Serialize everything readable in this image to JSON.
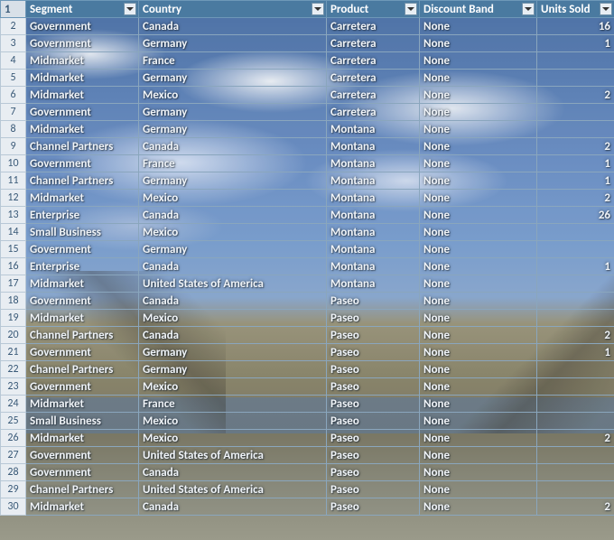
{
  "header": {
    "row_number": "1",
    "columns": [
      "Segment",
      "Country",
      "Product",
      "Discount Band",
      "Units Sold"
    ]
  },
  "rows": [
    {
      "n": "2",
      "segment": "Government",
      "country": "Canada",
      "product": "Carretera",
      "discount": "None",
      "units": "16"
    },
    {
      "n": "3",
      "segment": "Government",
      "country": "Germany",
      "product": "Carretera",
      "discount": "None",
      "units": "1"
    },
    {
      "n": "4",
      "segment": "Midmarket",
      "country": "France",
      "product": "Carretera",
      "discount": "None",
      "units": ""
    },
    {
      "n": "5",
      "segment": "Midmarket",
      "country": "Germany",
      "product": "Carretera",
      "discount": "None",
      "units": ""
    },
    {
      "n": "6",
      "segment": "Midmarket",
      "country": "Mexico",
      "product": "Carretera",
      "discount": "None",
      "units": "2"
    },
    {
      "n": "7",
      "segment": "Government",
      "country": "Germany",
      "product": "Carretera",
      "discount": "None",
      "units": ""
    },
    {
      "n": "8",
      "segment": "Midmarket",
      "country": "Germany",
      "product": "Montana",
      "discount": "None",
      "units": ""
    },
    {
      "n": "9",
      "segment": "Channel Partners",
      "country": "Canada",
      "product": "Montana",
      "discount": "None",
      "units": "2"
    },
    {
      "n": "10",
      "segment": "Government",
      "country": "France",
      "product": "Montana",
      "discount": "None",
      "units": "1"
    },
    {
      "n": "11",
      "segment": "Channel Partners",
      "country": "Germany",
      "product": "Montana",
      "discount": "None",
      "units": "1"
    },
    {
      "n": "12",
      "segment": "Midmarket",
      "country": "Mexico",
      "product": "Montana",
      "discount": "None",
      "units": "2"
    },
    {
      "n": "13",
      "segment": "Enterprise",
      "country": "Canada",
      "product": "Montana",
      "discount": "None",
      "units": "26"
    },
    {
      "n": "14",
      "segment": "Small Business",
      "country": "Mexico",
      "product": "Montana",
      "discount": "None",
      "units": ""
    },
    {
      "n": "15",
      "segment": "Government",
      "country": "Germany",
      "product": "Montana",
      "discount": "None",
      "units": ""
    },
    {
      "n": "16",
      "segment": "Enterprise",
      "country": "Canada",
      "product": "Montana",
      "discount": "None",
      "units": "1"
    },
    {
      "n": "17",
      "segment": "Midmarket",
      "country": "United States of America",
      "product": "Montana",
      "discount": "None",
      "units": ""
    },
    {
      "n": "18",
      "segment": "Government",
      "country": "Canada",
      "product": "Paseo",
      "discount": "None",
      "units": ""
    },
    {
      "n": "19",
      "segment": "Midmarket",
      "country": "Mexico",
      "product": "Paseo",
      "discount": "None",
      "units": ""
    },
    {
      "n": "20",
      "segment": "Channel Partners",
      "country": "Canada",
      "product": "Paseo",
      "discount": "None",
      "units": "2"
    },
    {
      "n": "21",
      "segment": "Government",
      "country": "Germany",
      "product": "Paseo",
      "discount": "None",
      "units": "1"
    },
    {
      "n": "22",
      "segment": "Channel Partners",
      "country": "Germany",
      "product": "Paseo",
      "discount": "None",
      "units": ""
    },
    {
      "n": "23",
      "segment": "Government",
      "country": "Mexico",
      "product": "Paseo",
      "discount": "None",
      "units": ""
    },
    {
      "n": "24",
      "segment": "Midmarket",
      "country": "France",
      "product": "Paseo",
      "discount": "None",
      "units": ""
    },
    {
      "n": "25",
      "segment": "Small Business",
      "country": "Mexico",
      "product": "Paseo",
      "discount": "None",
      "units": ""
    },
    {
      "n": "26",
      "segment": "Midmarket",
      "country": "Mexico",
      "product": "Paseo",
      "discount": "None",
      "units": "2"
    },
    {
      "n": "27",
      "segment": "Government",
      "country": "United States of America",
      "product": "Paseo",
      "discount": "None",
      "units": ""
    },
    {
      "n": "28",
      "segment": "Government",
      "country": "Canada",
      "product": "Paseo",
      "discount": "None",
      "units": ""
    },
    {
      "n": "29",
      "segment": "Channel Partners",
      "country": "United States of America",
      "product": "Paseo",
      "discount": "None",
      "units": ""
    },
    {
      "n": "30",
      "segment": "Midmarket",
      "country": "Canada",
      "product": "Paseo",
      "discount": "None",
      "units": "2"
    }
  ]
}
